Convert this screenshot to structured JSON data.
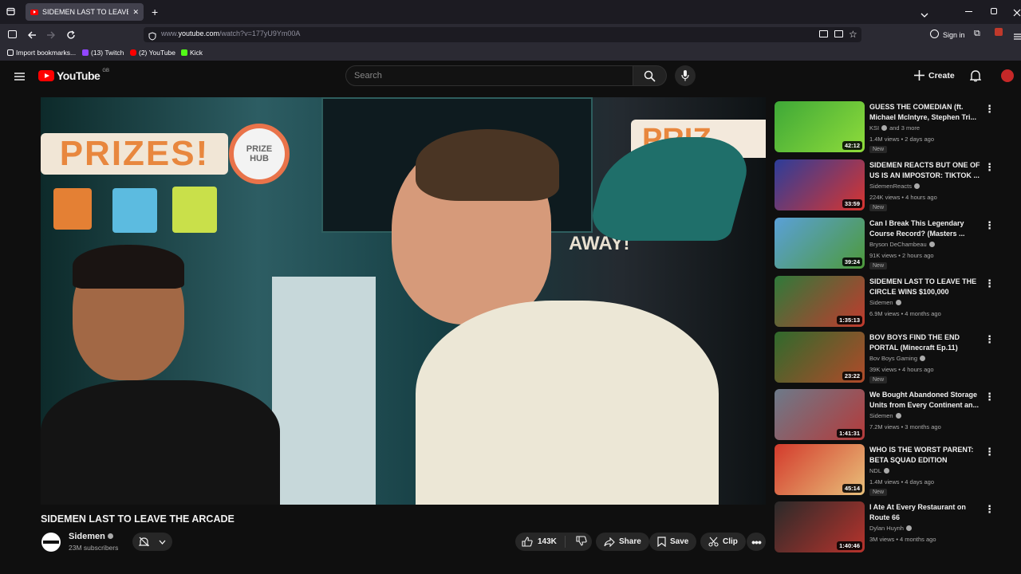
{
  "browser": {
    "tab_title": "SIDEMEN LAST TO LEAVE THE ARCADE",
    "tab_close": "✕",
    "new_tab": "+",
    "url_prefix": "www.",
    "url_host": "youtube.com",
    "url_path": "/watch?v=177yU9Ym00A",
    "sign_in": "Sign in",
    "bookmarks": [
      {
        "label": "Import bookmarks...",
        "color": "#fbfbfe"
      },
      {
        "label": "(13) Twitch",
        "color": "#9146ff"
      },
      {
        "label": "(2) YouTube",
        "color": "#ff0000"
      },
      {
        "label": "Kick",
        "color": "#53fc18"
      }
    ]
  },
  "header": {
    "logo_text": "YouTube",
    "region": "GB",
    "search_placeholder": "Search",
    "create_label": "Create"
  },
  "video": {
    "title": "SIDEMEN LAST TO LEAVE THE ARCADE",
    "scene_text": {
      "prizes_left": "PRIZES!",
      "prizes_right": "PRIZ",
      "away": "AWAY!",
      "prize_hub": "PRIZE HUB"
    }
  },
  "channel": {
    "name": "Sidemen",
    "subscribers": "23M subscribers"
  },
  "actions": {
    "likes": "143K",
    "share": "Share",
    "save": "Save",
    "clip": "Clip"
  },
  "recommendations": [
    {
      "title": "GUESS THE COMEDIAN (ft. Michael McIntyre, Stephen Tri...",
      "channel": "KSI",
      "extra": "and 3 more",
      "meta": "1.4M views • 2 days ago",
      "badge": "New",
      "duration": "42:12",
      "bg": "#3ea838",
      "bg2": "#8fdc3a"
    },
    {
      "title": "SIDEMEN REACTS BUT ONE OF US IS AN IMPOSTOR: TIKTOK ...",
      "channel": "SidemenReacts",
      "extra": "",
      "meta": "224K views • 4 hours ago",
      "badge": "New",
      "duration": "33:59",
      "bg": "#2c3d9a",
      "bg2": "#d9352f"
    },
    {
      "title": "Can I Break This Legendary Course Record? (Masters ...",
      "channel": "Bryson DeChambeau",
      "extra": "",
      "meta": "91K views • 2 hours ago",
      "badge": "New",
      "duration": "39:24",
      "bg": "#5aa0d8",
      "bg2": "#4d9a3a"
    },
    {
      "title": "SIDEMEN LAST TO LEAVE THE CIRCLE WINS $100,000",
      "channel": "Sidemen",
      "extra": "",
      "meta": "6.9M views • 4 months ago",
      "badge": "",
      "duration": "1:35:13",
      "bg": "#2f7a3a",
      "bg2": "#c23a2e"
    },
    {
      "title": "BOV BOYS FIND THE END PORTAL (Minecraft Ep.11)",
      "channel": "Bov Boys Gaming",
      "extra": "",
      "meta": "39K views • 4 hours ago",
      "badge": "New",
      "duration": "23:22",
      "bg": "#2f6a2c",
      "bg2": "#b14a2a"
    },
    {
      "title": "We Bought Abandoned Storage Units from Every Continent an...",
      "channel": "Sidemen",
      "extra": "",
      "meta": "7.2M views • 3 months ago",
      "badge": "",
      "duration": "1:41:31",
      "bg": "#6c7a8a",
      "bg2": "#b53a3a"
    },
    {
      "title": "WHO IS THE WORST PARENT: BETA SQUAD EDITION",
      "channel": "NDL",
      "extra": "",
      "meta": "1.4M views • 4 days ago",
      "badge": "New",
      "duration": "45:14",
      "bg": "#d33a2c",
      "bg2": "#e9c07a"
    },
    {
      "title": "I Ate At Every Restaurant on Route 66",
      "channel": "Dylan Huynh",
      "extra": "",
      "meta": "3M views • 4 months ago",
      "badge": "",
      "duration": "1:40:46",
      "bg": "#2a2a2a",
      "bg2": "#b8332c"
    }
  ]
}
